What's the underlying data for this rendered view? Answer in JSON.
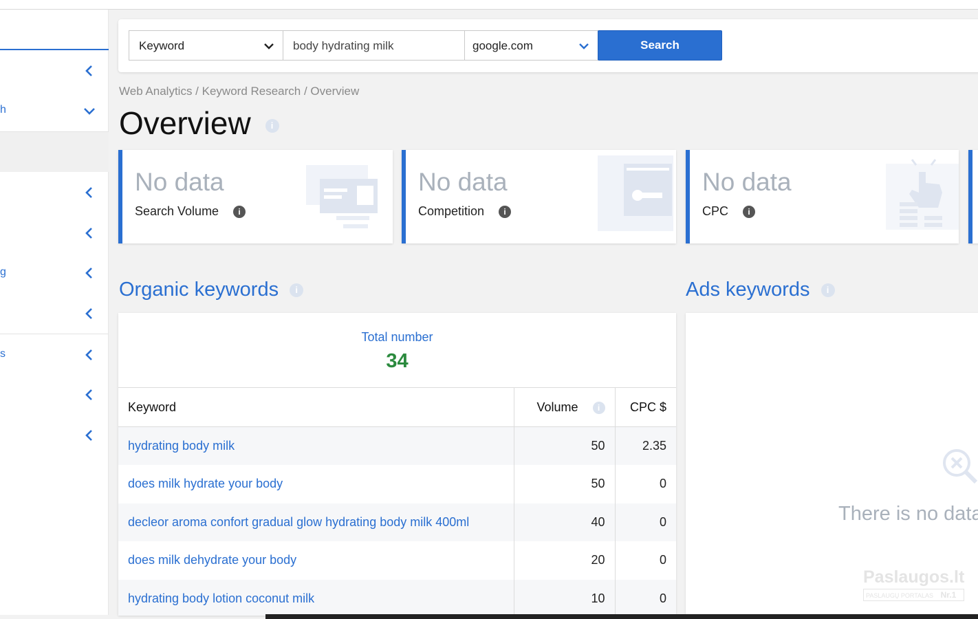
{
  "sidebar": {
    "items": [
      {
        "label": ""
      },
      {
        "label": "h"
      },
      {
        "label": ""
      },
      {
        "label": ""
      },
      {
        "label": "g"
      },
      {
        "label": ""
      },
      {
        "label": "s"
      },
      {
        "label": ""
      },
      {
        "label": ""
      }
    ]
  },
  "search": {
    "type_label": "Keyword",
    "query": "body hydrating milk",
    "engine": "google.com",
    "button": "Search"
  },
  "breadcrumb": "Web Analytics / Keyword Research / Overview",
  "page_title": "Overview",
  "cards": [
    {
      "value": "No data",
      "label": "Search Volume"
    },
    {
      "value": "No data",
      "label": "Competition"
    },
    {
      "value": "No data",
      "label": "CPC"
    }
  ],
  "organic": {
    "title": "Organic keywords",
    "total_label": "Total number",
    "total_value": "34",
    "columns": [
      "Keyword",
      "Volume",
      "CPC $"
    ],
    "rows": [
      {
        "keyword": "hydrating body milk",
        "volume": "50",
        "cpc": "2.35"
      },
      {
        "keyword": "does milk hydrate your body",
        "volume": "50",
        "cpc": "0"
      },
      {
        "keyword": "decleor aroma confort gradual glow hydrating body milk 400ml",
        "volume": "40",
        "cpc": "0"
      },
      {
        "keyword": "does milk dehydrate your body",
        "volume": "20",
        "cpc": "0"
      },
      {
        "keyword": "hydrating body lotion coconut milk",
        "volume": "10",
        "cpc": "0"
      }
    ]
  },
  "ads": {
    "title": "Ads keywords",
    "empty_text": "There is no data t"
  },
  "watermark": {
    "line1": "Paslaugos.lt",
    "line2": "PASLAUGŲ PORTALAS",
    "badge": "Nr.1"
  },
  "colors": {
    "accent": "#2a6fd1",
    "total": "#2b8a3e",
    "muted": "#a9b1bb"
  }
}
